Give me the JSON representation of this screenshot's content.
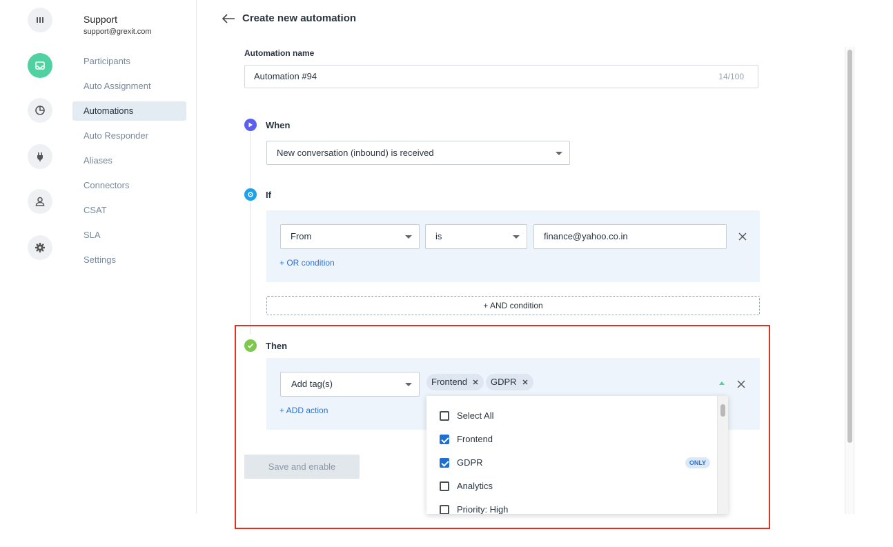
{
  "rail": {
    "icons": [
      "bar-chart-icon",
      "inbox-icon",
      "pie-chart-icon",
      "plug-icon",
      "user-icon",
      "gear-icon"
    ],
    "active_color": "#4fd1a1"
  },
  "sidebar": {
    "team_name": "Support",
    "team_email": "support@grexit.com",
    "items": [
      {
        "label": "Participants"
      },
      {
        "label": "Auto Assignment"
      },
      {
        "label": "Automations",
        "active": true
      },
      {
        "label": "Auto Responder"
      },
      {
        "label": "Aliases"
      },
      {
        "label": "Connectors"
      },
      {
        "label": "CSAT"
      },
      {
        "label": "SLA"
      },
      {
        "label": "Settings"
      }
    ]
  },
  "header": {
    "title": "Create new automation"
  },
  "form": {
    "name_label": "Automation name",
    "name_value": "Automation #94",
    "name_count": "14/100",
    "when": {
      "label": "When",
      "trigger": "New conversation (inbound) is received"
    },
    "if": {
      "label": "If",
      "field": "From",
      "operator": "is",
      "value": "finance@yahoo.co.in",
      "or_link": "+ OR condition",
      "and_button": "+ AND condition"
    },
    "then": {
      "label": "Then",
      "action": "Add tag(s)",
      "tags": [
        "Frontend",
        "GDPR"
      ],
      "add_action_link": "+ ADD action"
    },
    "save_button": "Save and enable"
  },
  "dropdown": {
    "items": [
      {
        "label": "Select All",
        "checked": false
      },
      {
        "label": "Frontend",
        "checked": true
      },
      {
        "label": "GDPR",
        "checked": true,
        "badge": "ONLY"
      },
      {
        "label": "Analytics",
        "checked": false
      },
      {
        "label": "Priority: High",
        "checked": false
      }
    ]
  },
  "colors": {
    "accent_blue": "#2c73d2",
    "highlight_red": "#e0301e",
    "when_dot": "#5b5ef0",
    "if_dot": "#1aa3e8",
    "then_dot": "#7cc84a"
  }
}
